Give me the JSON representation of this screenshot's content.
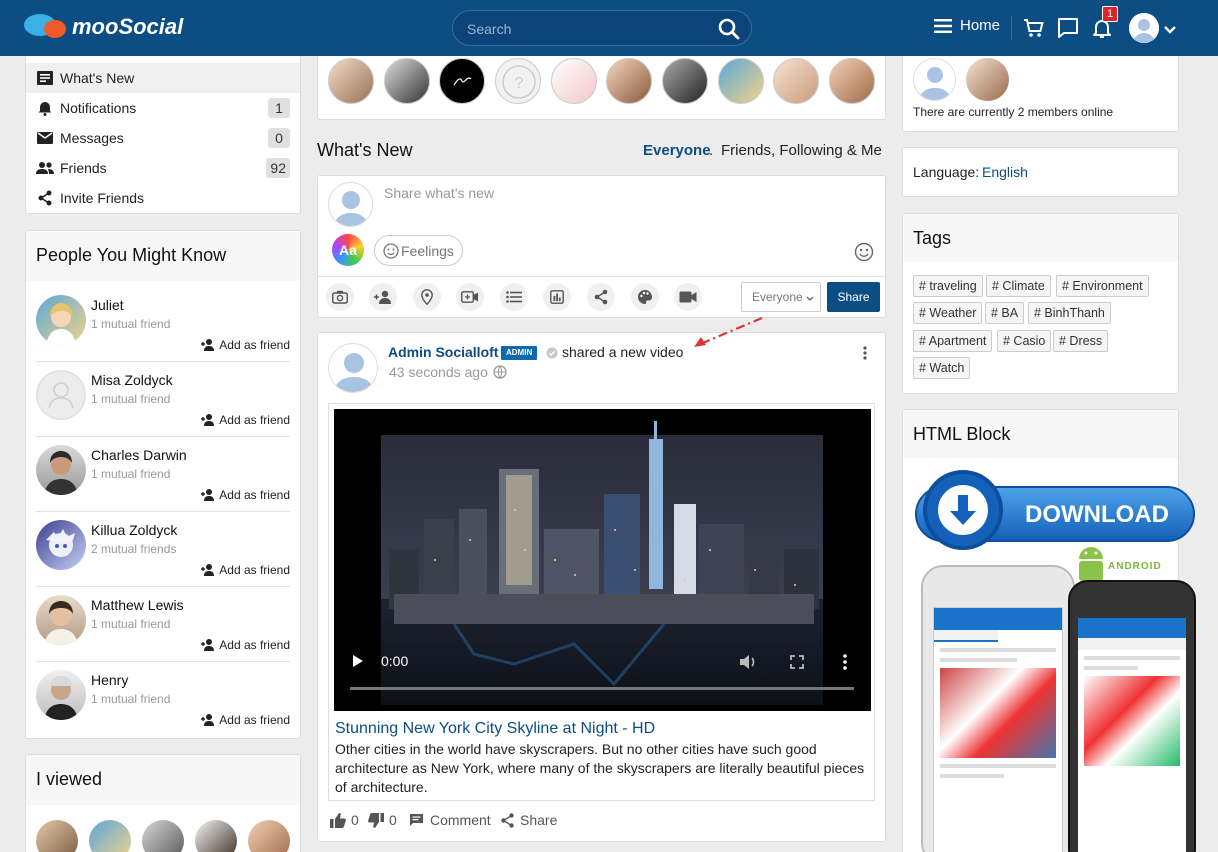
{
  "header": {
    "logo_text": "mooSocial",
    "search_placeholder": "Search",
    "home_label": "Home",
    "notification_count": "1"
  },
  "left_menu": {
    "items": [
      {
        "label": "What's New",
        "count": null
      },
      {
        "label": "Notifications",
        "count": "1"
      },
      {
        "label": "Messages",
        "count": "0"
      },
      {
        "label": "Friends",
        "count": "92"
      },
      {
        "label": "Invite Friends",
        "count": null
      }
    ]
  },
  "people": {
    "title": "People You Might Know",
    "add_label": "Add as friend",
    "list": [
      {
        "name": "Juliet",
        "mutual": "1 mutual friend"
      },
      {
        "name": "Misa Zoldyck",
        "mutual": "1 mutual friend"
      },
      {
        "name": "Charles Darwin",
        "mutual": "1 mutual friend"
      },
      {
        "name": "Killua Zoldyck",
        "mutual": "2 mutual friends"
      },
      {
        "name": "Matthew Lewis",
        "mutual": "1 mutual friend"
      },
      {
        "name": "Henry",
        "mutual": "1 mutual friend"
      }
    ]
  },
  "viewed": {
    "title": "I viewed"
  },
  "feed": {
    "title": "What's New",
    "filter_everyone": "Everyone",
    "filter_sep": ".",
    "filter_friends": "Friends, Following & Me",
    "composer_placeholder": "Share what's new",
    "aa_label": "Aa",
    "feelings_label": "Feelings",
    "privacy_value": "Everyone",
    "share_button": "Share"
  },
  "post": {
    "author": "Admin Socialloft",
    "badge": "ADMIN",
    "action": "shared a new video",
    "time": "43 seconds ago",
    "video_time": "0:00",
    "video_title": "Stunning New York City Skyline at Night - HD",
    "video_desc": "Other cities in the world have skyscrapers. But no other cities have such good architecture as New York, where many of the skyscrapers are literally beautiful pieces of architecture.",
    "likes": "0",
    "dislikes": "0",
    "comment_label": "Comment",
    "share_label": "Share"
  },
  "online": {
    "text": "There are currently 2 members online"
  },
  "language": {
    "label": "Language:",
    "value": "English"
  },
  "tags": {
    "title": "Tags",
    "items": [
      "# traveling",
      "# Climate",
      "# Environment",
      "# Weather",
      "# BA",
      "# BinhThanh",
      "# Apartment",
      "# Casio",
      "# Dress",
      "# Watch"
    ]
  },
  "html_block": {
    "title": "HTML Block",
    "download_label": "DOWNLOAD",
    "android_label": "ANDROID"
  },
  "colors": {
    "header_bg": "#0c4d84",
    "link": "#0c4d84",
    "share_btn": "#0c4d84",
    "download_blue": "#1a73c8"
  }
}
